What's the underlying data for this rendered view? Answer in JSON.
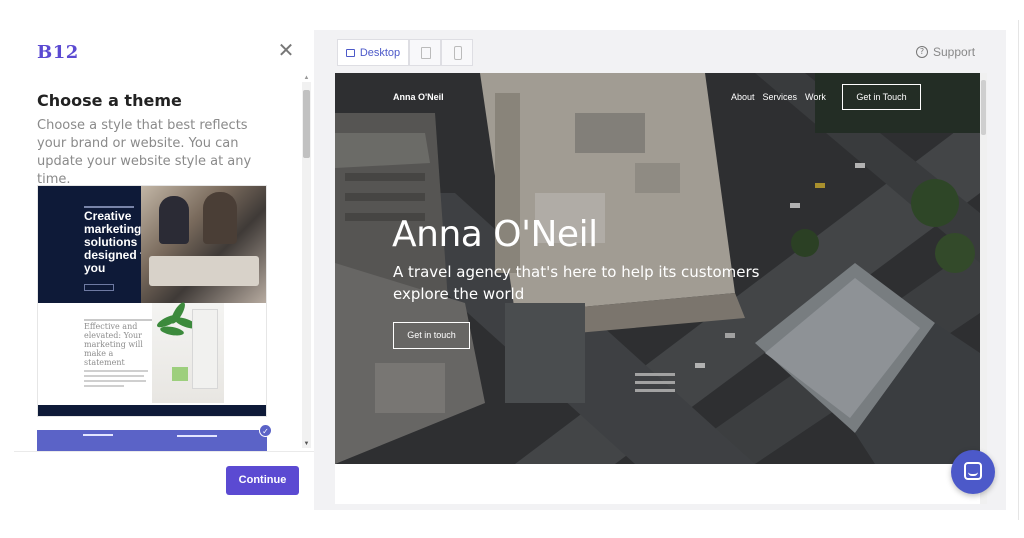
{
  "app": {
    "logo": "B12",
    "close_label": "✕"
  },
  "panel": {
    "heading": "Choose a theme",
    "description": "Choose a style that best reflects your brand or website. You can update your website style at any time.",
    "continue_label": "Continue"
  },
  "theme_card": {
    "headline": "Creative marketing solutions designed for you",
    "subheadline": "Effective and elevated: Your marketing will make a statement"
  },
  "toolbar": {
    "desktop_label": "Desktop",
    "support_label": "Support",
    "support_icon": "?"
  },
  "preview": {
    "site_name": "Anna O'Neil",
    "nav": [
      "About",
      "Services",
      "Work"
    ],
    "cta": "Get in Touch",
    "hero_title": "Anna O'Neil",
    "hero_subtitle": "A travel agency that's here to help its customers explore the world",
    "hero_button": "Get in touch"
  },
  "colors": {
    "brand": "#5b4ad2",
    "accent": "#4c59c9",
    "theme_dark": "#0e1a38"
  },
  "icons": {
    "close": "close-icon",
    "desktop": "monitor-icon",
    "tablet": "tablet-icon",
    "mobile": "mobile-icon",
    "support": "help-circle-icon",
    "chat": "chat-icon",
    "selected": "check-icon"
  }
}
